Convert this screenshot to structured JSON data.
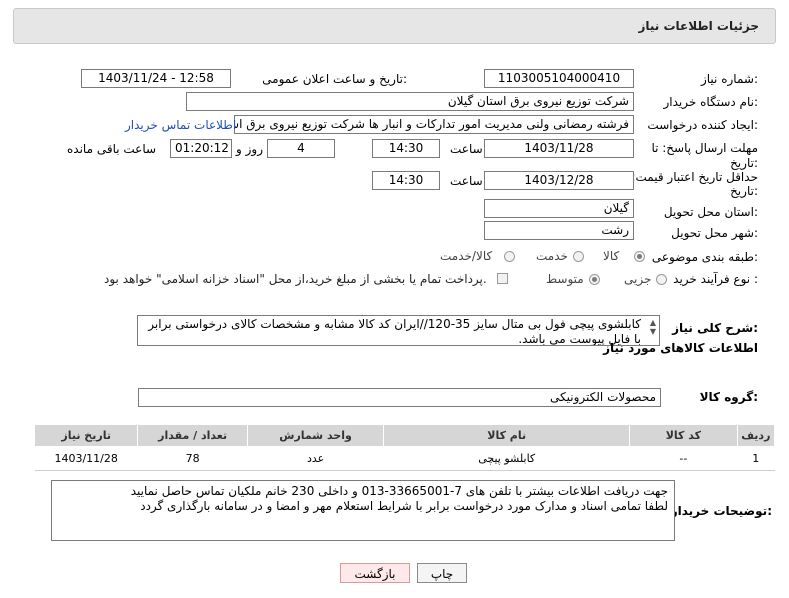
{
  "header": {
    "title": "جزئیات اطلاعات نیاز"
  },
  "fields": {
    "need_number_label": "شماره نیاز:",
    "need_number": "1103005104000410",
    "announce_label": "تاریخ و ساعت اعلان عمومی:",
    "announce_value": "1403/11/24 - 12:58",
    "buyer_org_label": "نام دستگاه خریدار:",
    "buyer_org": "شرکت توزیع نیروی برق استان گیلان",
    "creator_label": "ایجاد کننده درخواست:",
    "creator": "فرشته رمضانی ولنی مدیریت امور تدارکات و انبار ها شرکت توزیع نیروی برق استان",
    "contact_link": "اطلاعات تماس خریدار",
    "deadline_label": "مهلت ارسال پاسخ: تا",
    "deadline_label2": "تاریخ:",
    "deadline_date": "1403/11/28",
    "time_label": "ساعت",
    "deadline_time": "14:30",
    "days_value": "4",
    "days_label": "روز و",
    "remaining_time": "01:20:12",
    "remaining_label": "ساعت باقی مانده",
    "validity_label": "حداقل تاریخ اعتبار قیمت: تا",
    "validity_label2": "تاریخ:",
    "validity_date": "1403/12/28",
    "validity_time": "14:30",
    "province_label": "استان محل تحویل:",
    "province": "گیلان",
    "city_label": "شهر محل تحویل:",
    "city": "رشت",
    "category_label": "طبقه بندی موضوعی:",
    "category_options": [
      "کالا",
      "خدمت",
      "کالا/خدمت"
    ],
    "process_label": "نوع فرآیند خرید :",
    "process_options": [
      "جزیی",
      "متوسط"
    ],
    "payment_note": "پرداخت تمام یا بخشی از مبلغ خرید،از محل \"اسناد خزانه اسلامی\" خواهد بود."
  },
  "description": {
    "label": "شرح کلی نیاز:",
    "text": "کابلشوی پیچی فول بی متال سایز 35-120//ایران کد کالا مشابه و مشخصات کالای درخواستی برابر با فایل پیوست می باشد."
  },
  "goods_info_title": "اطلاعات کالاهای مورد نیاز",
  "goods_group": {
    "label": "گروه کالا:",
    "value": "محصولات الکترونیکی"
  },
  "table": {
    "headers": [
      "ردیف",
      "کد کالا",
      "نام کالا",
      "واحد شمارش",
      "تعداد / مقدار",
      "تاریخ نیاز"
    ],
    "rows": [
      [
        "1",
        "--",
        "کابلشو پیچی",
        "عدد",
        "78",
        "1403/11/28"
      ]
    ]
  },
  "buyer_notes": {
    "label": "توضیحات خریدار:",
    "line1": "جهت دریافت اطلاعات بیشتر با تلفن های 7-33665001-013 و داخلی 230 خانم ملکیان تماس حاصل نمایید",
    "line2": "لطفا تمامی اسناد و مدارک مورد درخواست برابر با شرایط استعلام مهر و امضا و در سامانه بارگذاری گردد"
  },
  "buttons": {
    "print": "چاپ",
    "back": "بازگشت"
  },
  "colors": {
    "link": "#1f4fbf",
    "header_bg": "#e6e6e6",
    "back_button_bg": "#fde8ea"
  }
}
